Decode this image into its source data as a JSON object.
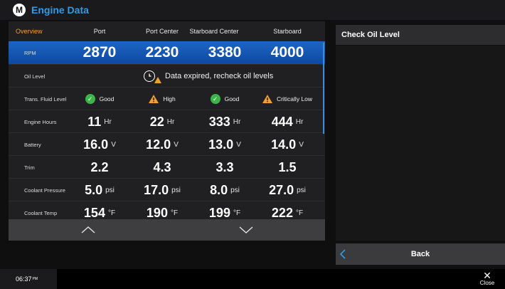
{
  "header": {
    "title": "Engine Data"
  },
  "table": {
    "overview_label": "Overview",
    "columns": [
      "Port",
      "Port Center",
      "Starboard Center",
      "Starboard"
    ],
    "rows": {
      "rpm": {
        "label": "RPM",
        "values": [
          "2870",
          "2230",
          "3380",
          "4000"
        ]
      },
      "oil": {
        "label": "Oil Level",
        "message": "Data expired, recheck oil levels"
      },
      "trans": {
        "label": "Trans. Fluid Level",
        "values": [
          "Good",
          "High",
          "Good",
          "Critically Low"
        ],
        "icons": [
          "check-icon",
          "warning-icon",
          "check-icon",
          "warning-icon"
        ]
      },
      "hours": {
        "label": "Engine Hours",
        "values": [
          "11",
          "22",
          "333",
          "444"
        ],
        "unit": "Hr"
      },
      "battery": {
        "label": "Battery",
        "values": [
          "16.0",
          "12.0",
          "13.0",
          "14.0"
        ],
        "unit": "V"
      },
      "trim": {
        "label": "Trim",
        "values": [
          "2.2",
          "4.3",
          "3.3",
          "1.5"
        ]
      },
      "coolant_pressure": {
        "label": "Coolant Pressure",
        "values": [
          "5.0",
          "17.0",
          "8.0",
          "27.0"
        ],
        "unit": "psi"
      },
      "coolant_temp": {
        "label": "Coolant Temp",
        "values": [
          "154",
          "190",
          "199",
          "222"
        ],
        "unit": "°F"
      }
    }
  },
  "panel": {
    "title": "Check Oil Level",
    "back_label": "Back"
  },
  "footer": {
    "time": "06:37",
    "time_suffix": "PM",
    "close_label": "Close"
  },
  "colors": {
    "accent": "#2f9be6",
    "orange": "#f0a030",
    "good": "#3bb54a",
    "rpm_bg": "#1356b3"
  }
}
